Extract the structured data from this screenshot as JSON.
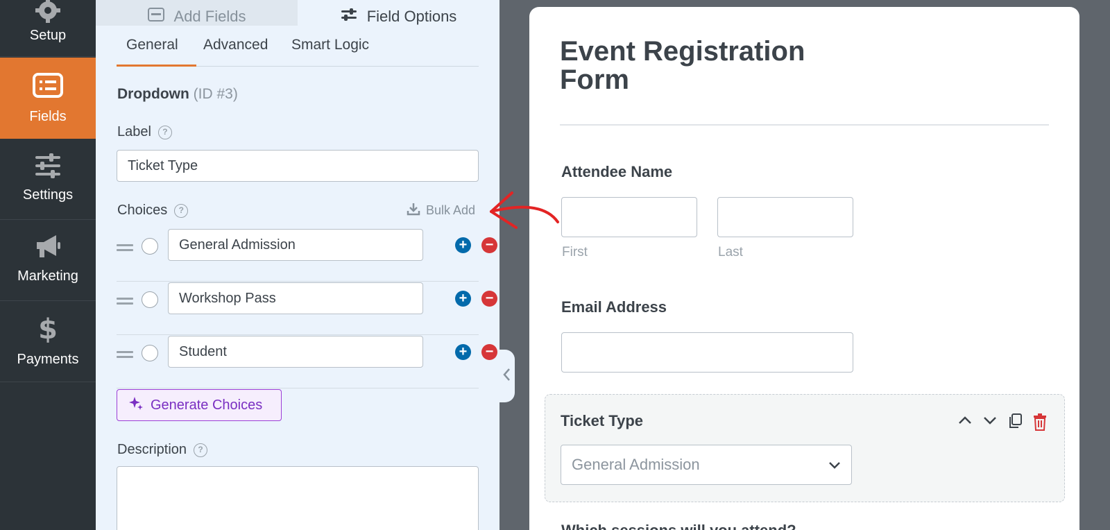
{
  "nav": {
    "items": [
      {
        "label": "Setup",
        "icon": "gear-icon"
      },
      {
        "label": "Fields",
        "icon": "list-icon",
        "active": true
      },
      {
        "label": "Settings",
        "icon": "sliders-icon"
      },
      {
        "label": "Marketing",
        "icon": "megaphone-icon"
      },
      {
        "label": "Payments",
        "icon": "dollar-icon"
      }
    ]
  },
  "panel": {
    "top_tabs": {
      "add_fields": "Add Fields",
      "field_options": "Field Options"
    },
    "sub_tabs": {
      "general": "General",
      "advanced": "Advanced",
      "smart_logic": "Smart Logic"
    },
    "field_type": "Dropdown",
    "field_id": "(ID #3)",
    "label_title": "Label",
    "label_value": "Ticket Type",
    "choices_title": "Choices",
    "bulk_add": "Bulk Add",
    "choices": [
      {
        "value": "General Admission"
      },
      {
        "value": "Workshop Pass"
      },
      {
        "value": "Student"
      }
    ],
    "generate_choices": "Generate Choices",
    "description_title": "Description"
  },
  "form": {
    "title": "Event Registration Form",
    "attendee_label": "Attendee Name",
    "first_label": "First",
    "last_label": "Last",
    "email_label": "Email Address",
    "ticket_label": "Ticket Type",
    "ticket_selected": "General Admission",
    "next_question": "Which sessions will you attend?"
  },
  "colors": {
    "accent": "#e27730",
    "nav_bg": "#2c3338",
    "add_btn": "#036aab",
    "remove_btn": "#d63638",
    "ai_purple": "#7a2fc2",
    "annotation_red": "#e32424"
  }
}
